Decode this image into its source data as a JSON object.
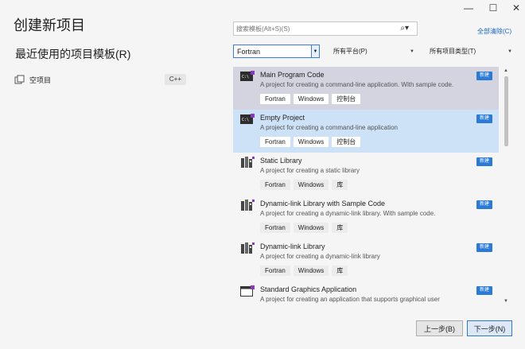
{
  "window_controls": {
    "minimize": "—",
    "maximize": "☐",
    "close": "✕"
  },
  "page_title": "创建新项目",
  "recent_title": "最近使用的项目模板(R)",
  "recent_items": [
    {
      "label": "空项目",
      "lang": "C++"
    }
  ],
  "search": {
    "placeholder": "搜索模板(Alt+S)(S)",
    "icon": "search-icon"
  },
  "clear_all": "全部清除(C)",
  "filters": {
    "language": "Fortran",
    "platform": "所有平台(P)",
    "project_type": "所有项目类型(T)"
  },
  "templates": [
    {
      "name": "Main Program Code",
      "desc": "A project for creating a command-line application. With sample code.",
      "tags": [
        "Fortran",
        "Windows",
        "控制台"
      ],
      "badge": "新建",
      "icon": "console-icon"
    },
    {
      "name": "Empty Project",
      "desc": "A project for creating a command-line application",
      "tags": [
        "Fortran",
        "Windows",
        "控制台"
      ],
      "badge": "新建",
      "icon": "console-icon"
    },
    {
      "name": "Static Library",
      "desc": "A project for creating a static library",
      "tags": [
        "Fortran",
        "Windows",
        "库"
      ],
      "badge": "新建",
      "icon": "library-icon"
    },
    {
      "name": "Dynamic-link Library with Sample Code",
      "desc": "A project for creating a dynamic-link library. With sample code.",
      "tags": [
        "Fortran",
        "Windows",
        "库"
      ],
      "badge": "新建",
      "icon": "library-icon"
    },
    {
      "name": "Dynamic-link Library",
      "desc": "A project for creating a dynamic-link library",
      "tags": [
        "Fortran",
        "Windows",
        "库"
      ],
      "badge": "新建",
      "icon": "library-icon"
    },
    {
      "name": "Standard Graphics Application",
      "desc": "A project for creating an application that supports graphical user",
      "tags": [],
      "badge": "新建",
      "icon": "window-app-icon"
    }
  ],
  "buttons": {
    "back": "上一步(B)",
    "next": "下一步(N)"
  },
  "colors": {
    "accent": "#2b7bd6",
    "selected_card": "#cde2f6",
    "hover_card": "#d4d4e0"
  }
}
